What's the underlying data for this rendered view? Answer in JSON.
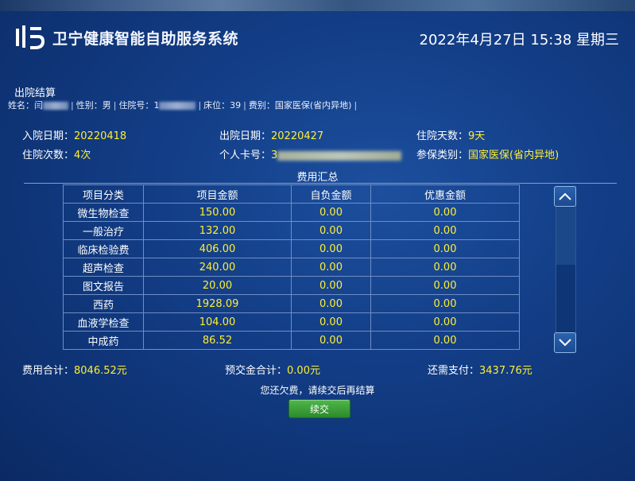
{
  "header": {
    "app_title": "卫宁健康智能自助服务系统",
    "datetime": "2022年4月27日 15:38 星期三"
  },
  "section_title": "出院结算",
  "patient": {
    "name_label": "姓名：",
    "name_value": "闫",
    "gender_label": "性别：",
    "gender_value": "男",
    "admission_no_label": "住院号：",
    "admission_no_value": "1",
    "bed_label": "床位：",
    "bed_value": "39",
    "fee_type_label": "费别：",
    "fee_type_value": "国家医保(省内异地)"
  },
  "info": {
    "admit_date_label": "入院日期：",
    "admit_date": "20220418",
    "discharge_date_label": "出院日期：",
    "discharge_date": "20220427",
    "stay_days_label": "住院天数：",
    "stay_days": "9天",
    "admit_count_label": "住院次数：",
    "admit_count": "4次",
    "card_no_label": "个人卡号：",
    "card_no": "3",
    "insurance_type_label": "参保类别：",
    "insurance_type": "国家医保(省内异地)"
  },
  "summary_title": "费用汇总",
  "table": {
    "headers": [
      "项目分类",
      "项目金额",
      "自负金额",
      "优惠金额"
    ],
    "rows": [
      [
        "微生物检查",
        "150.00",
        "0.00",
        "0.00"
      ],
      [
        "一般治疗",
        "132.00",
        "0.00",
        "0.00"
      ],
      [
        "临床检验费",
        "406.00",
        "0.00",
        "0.00"
      ],
      [
        "超声检查",
        "240.00",
        "0.00",
        "0.00"
      ],
      [
        "图文报告",
        "20.00",
        "0.00",
        "0.00"
      ],
      [
        "西药",
        "1928.09",
        "0.00",
        "0.00"
      ],
      [
        "血液学检查",
        "104.00",
        "0.00",
        "0.00"
      ],
      [
        "中成药",
        "86.52",
        "0.00",
        "0.00"
      ]
    ]
  },
  "totals": {
    "total_label": "费用合计：",
    "total_value": "8046.52元",
    "deposit_label": "预交金合计：",
    "deposit_value": "0.00元",
    "due_label": "还需支付：",
    "due_value": "3437.76元"
  },
  "notice": "您还欠费，请续交后再结算",
  "pay_button_label": "续交",
  "colors": {
    "highlight": "#ffee33",
    "button": "#3aa035",
    "background": "#123c84"
  }
}
